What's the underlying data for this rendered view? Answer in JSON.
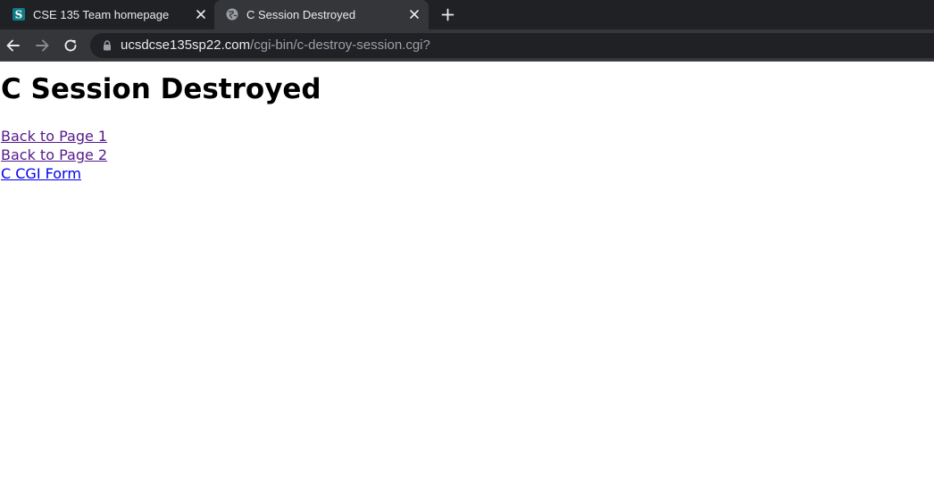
{
  "browser": {
    "tabs": [
      {
        "title": "CSE 135 Team homepage",
        "favicon": "s-logo-icon",
        "active": false
      },
      {
        "title": "C Session Destroyed",
        "favicon": "globe-icon",
        "active": true
      }
    ],
    "address_bar": {
      "host": "ucsdcse135sp22.com",
      "path": "/cgi-bin/c-destroy-session.cgi?"
    },
    "colors": {
      "tab_strip": "#202124",
      "active_tab": "#35363a",
      "omnibox": "#202124",
      "text": "#e8eaed",
      "muted": "#9aa0a6"
    }
  },
  "page": {
    "title": "C Session Destroyed",
    "links": [
      {
        "label": "Back to Page 1",
        "visited": true
      },
      {
        "label": "Back to Page 2",
        "visited": true
      },
      {
        "label": "C CGI Form",
        "visited": false
      }
    ],
    "colors": {
      "visited_link": "#551a8b",
      "unvisited_link": "#0000ee"
    }
  }
}
